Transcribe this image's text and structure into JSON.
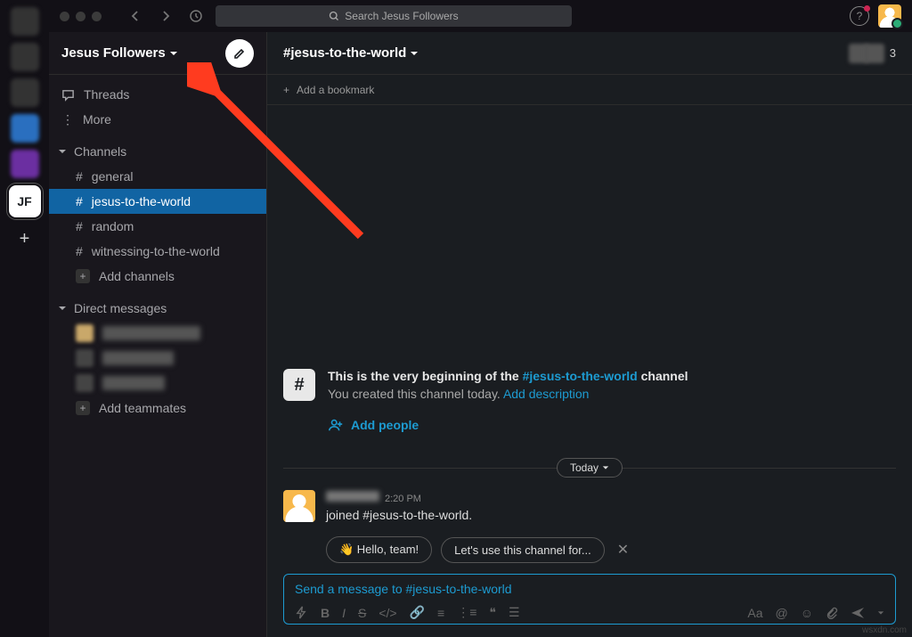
{
  "workspace": {
    "name": "Jesus Followers",
    "badge": "JF",
    "search_placeholder": "Search Jesus Followers"
  },
  "sidebar": {
    "threads": "Threads",
    "more": "More",
    "channels_label": "Channels",
    "channels": [
      {
        "name": "general"
      },
      {
        "name": "jesus-to-the-world",
        "active": true
      },
      {
        "name": "random"
      },
      {
        "name": "witnessing-to-the-world"
      }
    ],
    "add_channels": "Add channels",
    "dm_label": "Direct messages",
    "add_teammates": "Add teammates"
  },
  "channel": {
    "name": "#jesus-to-the-world",
    "member_count": "3",
    "add_bookmark": "Add a bookmark",
    "intro_prefix": "This is the very beginning of the ",
    "intro_link": "#jesus-to-the-world",
    "intro_suffix": " channel",
    "created": "You created this channel today. ",
    "add_desc": "Add description",
    "add_people": "Add people",
    "divider": "Today",
    "msg_time": "2:20 PM",
    "msg_text": "joined #jesus-to-the-world.",
    "suggest1": "👋 Hello, team!",
    "suggest2": "Let's use this channel for...",
    "placeholder": "Send a message to #jesus-to-the-world"
  },
  "footer": "wsxdn.com"
}
